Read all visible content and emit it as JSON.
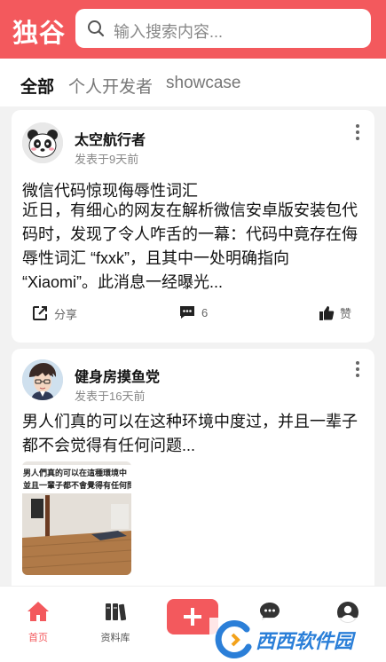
{
  "app": {
    "logo": "独谷"
  },
  "search": {
    "placeholder": "输入搜索内容..."
  },
  "tabs": [
    {
      "label": "全部",
      "active": true
    },
    {
      "label": "个人开发者",
      "active": false
    },
    {
      "label": "showcase",
      "active": false
    }
  ],
  "posts": [
    {
      "author": "太空航行者",
      "time": "发表于9天前",
      "title": "微信代码惊现侮辱性词汇",
      "body": "近日，有细心的网友在解析微信安卓版安装包代码时，发现了令人咋舌的一幕：代码中竟存在侮辱性词汇 “fxxk”，且其中一处明确指向 “Xiaomi”。此消息一经曝光...",
      "share_label": "分享",
      "comment_count": "6",
      "like_label": "赞"
    },
    {
      "author": "健身房摸鱼党",
      "time": "发表于16天前",
      "body": "男人们真的可以在这种环境中度过，并且一辈子都不会觉得有任何问题...",
      "thumb_caption_line1": "男人們真的可以在這種環境中",
      "thumb_caption_line2": "並且一輩子都不會覺得有任何問"
    }
  ],
  "bottom_nav": [
    {
      "label": "首页",
      "icon": "home-icon",
      "active": true
    },
    {
      "label": "资料库",
      "icon": "books-icon",
      "active": false
    },
    {
      "label": "",
      "icon": "plus-icon",
      "active": false
    },
    {
      "label": "",
      "icon": "chat-icon",
      "active": false
    },
    {
      "label": "",
      "icon": "profile-icon",
      "active": false
    }
  ],
  "watermark": {
    "text": "西西软件园"
  },
  "colors": {
    "accent": "#f3595d",
    "watermark": "#2b7fd8"
  }
}
